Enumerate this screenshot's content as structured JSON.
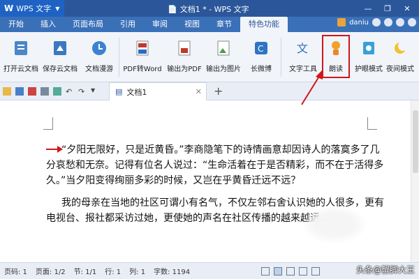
{
  "titlebar": {
    "app_name": "WPS 文字",
    "doc_title": "文档1 * - WPS 文字"
  },
  "menu": {
    "items": [
      "开始",
      "插入",
      "页面布局",
      "引用",
      "审阅",
      "视图",
      "章节",
      "特色功能"
    ],
    "active": "特色功能",
    "user": "daniu"
  },
  "ribbon": {
    "buttons": [
      {
        "label": "打开云文档",
        "icon": "cloud-open-icon"
      },
      {
        "label": "保存云文档",
        "icon": "cloud-save-icon"
      },
      {
        "label": "文档漫游",
        "icon": "roam-icon"
      },
      {
        "label": "PDF转Word",
        "icon": "pdf-to-word-icon"
      },
      {
        "label": "输出为PDF",
        "icon": "export-pdf-icon"
      },
      {
        "label": "输出为图片",
        "icon": "export-image-icon"
      },
      {
        "label": "长微博",
        "icon": "weibo-icon"
      },
      {
        "label": "文字工具",
        "icon": "text-tool-icon"
      },
      {
        "label": "朗读",
        "icon": "read-aloud-icon"
      },
      {
        "label": "护眼模式",
        "icon": "eye-care-icon"
      },
      {
        "label": "夜间模式",
        "icon": "night-mode-icon"
      }
    ],
    "highlighted": "朗读"
  },
  "tabs": {
    "doc_tab": "文档1"
  },
  "document": {
    "paragraphs": [
      "“夕阳无限好，只是近黄昏。”李商隐笔下的诗情画意却因诗人的落寞多了几分哀愁和无奈。记得有位名人说过：“生命活着在于是否精彩，而不在于活得多久。”当夕阳变得绚丽多彩的时候，又岂在乎黄昏迁远不远？",
      "我的母亲在当地的社区可谓小有名气，不仅左邻右舍认识她的人很多，更有电视台、报社都采访过她，更使她的声名在社区传播的越来越远..."
    ]
  },
  "status": {
    "page": "页码: 1",
    "pages": "页面: 1/2",
    "section": "节: 1/1",
    "row": "行: 1",
    "col": "列: 1",
    "words": "字数: 1194"
  },
  "watermark": "头条@蟹脚大王",
  "colors": {
    "title_bar": "#2b579a",
    "menu_bar": "#3a70b8",
    "highlight": "#d0161b"
  }
}
